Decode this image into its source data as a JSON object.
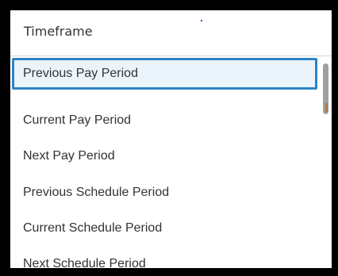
{
  "dropdown": {
    "title": "Timeframe",
    "options": [
      {
        "label": "Previous Pay Period",
        "selected": true
      },
      {
        "label": "Current Pay Period",
        "selected": false
      },
      {
        "label": "Next Pay Period",
        "selected": false
      },
      {
        "label": "Previous Schedule Period",
        "selected": false
      },
      {
        "label": "Current Schedule Period",
        "selected": false
      },
      {
        "label": "Next Schedule Period",
        "selected": false
      }
    ]
  },
  "colors": {
    "accent": "#2c84c6",
    "selected_bg": "#ecf4fb",
    "text": "#333333",
    "frame": "#000000"
  }
}
